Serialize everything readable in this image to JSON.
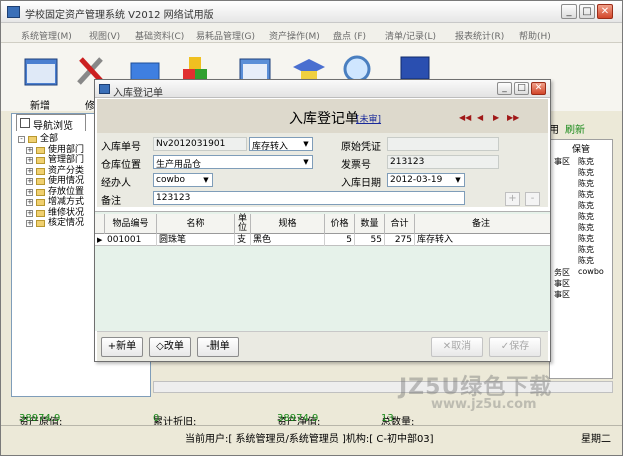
{
  "app": {
    "title": "学校固定资产管理系统 V2012 网络试用版"
  },
  "menu": [
    "系统管理(M)",
    "视图(V)",
    "基础资料(C)",
    "易耗品管理(G)",
    "资产操作(M)",
    "盘点 (F)",
    "清单/记录(L)",
    "报表统计(R)",
    "帮助(H)"
  ],
  "toolbar": {
    "new_label": "新增",
    "edit_label": "修"
  },
  "nav": {
    "tab_label": "导航浏览",
    "tree": [
      "全部",
      "使用部门",
      "管理部门",
      "资产分类",
      "使用情况",
      "存放位置",
      "增减方式",
      "维修状况",
      "核定情况"
    ]
  },
  "right_panel": {
    "partial_label": "用",
    "refresh_label": "刷新",
    "column_header": "保管",
    "cells": [
      "事区",
      "陈克",
      "陈克",
      "陈克",
      "陈克",
      "陈克",
      "陈克",
      "陈克",
      "陈克",
      "陈克",
      "陈克",
      "务区",
      "事区",
      "事区"
    ],
    "extra_cell": "cowbo"
  },
  "dialog": {
    "title": "入库登记单",
    "form_title": "入库登记单",
    "audit_status": "[未审]",
    "nav": [
      "◀◀",
      "◀",
      "▶",
      "▶▶"
    ],
    "fields": {
      "doc_no_label": "入库单号",
      "doc_no_value": "Nv2012031901",
      "type_value": "库存转入",
      "orig_voucher_label": "原始凭证",
      "orig_voucher_value": "",
      "warehouse_label": "仓库位置",
      "warehouse_value": "生产用品仓",
      "invoice_label": "发票号",
      "invoice_value": "213123",
      "handler_label": "经办人",
      "handler_value": "cowbo",
      "date_label": "入库日期",
      "date_value": "2012-03-19",
      "remark_label": "备注",
      "remark_value": "123123"
    },
    "mini_buttons": [
      "+",
      "-"
    ],
    "grid": {
      "headers": [
        "物品编号",
        "名称",
        "单位",
        "规格",
        "价格",
        "数量",
        "合计",
        "备注"
      ],
      "rows": [
        {
          "code": "001001",
          "name": "圆珠笔",
          "unit": "支",
          "spec": "黑色",
          "price": "5",
          "qty": "55",
          "total": "275",
          "remark": "库存转入"
        }
      ]
    },
    "buttons": {
      "add": "+新单",
      "edit": "◇改单",
      "delete": "-删单",
      "cancel": "取消",
      "save": "保存"
    }
  },
  "status": {
    "orig_value_label": "资产原值:",
    "orig_value": "38974.9",
    "depreciation_label": "累计折旧:",
    "depreciation": "0",
    "net_value_label": "资产净值:",
    "net_value": "38974.9",
    "total_label": "总数量:",
    "total": "13",
    "current_user": "当前用户:[ 系统管理员/系统管理员 ]机构:[ C-初中部03]",
    "weekday": "星期二"
  },
  "watermark": {
    "main": "JZ5U绿色下载",
    "site": "www.jz5u.com"
  },
  "colors": {
    "status_value": "#1a8a1a",
    "refresh": "#1a8a1a",
    "audit": "#1a2a9a",
    "nav_arrows": "#a01818"
  }
}
